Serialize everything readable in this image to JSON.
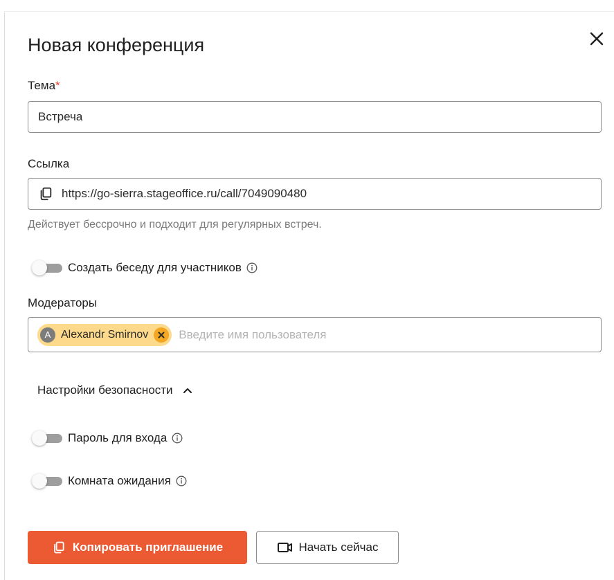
{
  "dialog": {
    "title": "Новая конференция",
    "close_icon": "close-icon"
  },
  "topic": {
    "label": "Тема",
    "required_mark": "*",
    "value": "Встреча"
  },
  "link": {
    "label": "Ссылка",
    "value": "https://go-sierra.stageoffice.ru/call/7049090480",
    "icon": "copy-icon",
    "hint": "Действует бессрочно и подходит для регулярных встреч."
  },
  "create_chat": {
    "label": "Создать беседу для участников",
    "enabled": false
  },
  "moderators": {
    "label": "Модераторы",
    "chips": [
      {
        "initial": "A",
        "name": "Alexandr Smirnov"
      }
    ],
    "placeholder": "Введите имя пользователя"
  },
  "security": {
    "header": "Настройки безопасности",
    "expanded": true,
    "password": {
      "label": "Пароль для входа",
      "enabled": false
    },
    "waiting_room": {
      "label": "Комната ожидания",
      "enabled": false
    }
  },
  "actions": {
    "copy_invite": "Копировать приглашение",
    "start_now": "Начать сейчас"
  },
  "colors": {
    "accent": "#ec5a33",
    "chip_bg": "#fcd98b",
    "chip_remove": "#f5a623",
    "required": "#e5472b"
  }
}
